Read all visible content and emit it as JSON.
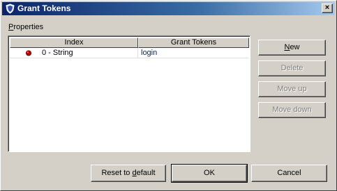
{
  "window": {
    "title": "Grant Tokens",
    "close_glyph": "×"
  },
  "properties": {
    "label_mnemonic": "P",
    "label_rest": "roperties"
  },
  "table": {
    "columns": [
      "Index",
      "Grant Tokens"
    ],
    "rows": [
      {
        "icon": "red-bullet-icon",
        "index": "0 - String",
        "value": "login"
      }
    ]
  },
  "side_buttons": {
    "new": {
      "mnemonic": "N",
      "rest": "ew"
    },
    "delete": "Delete",
    "move_up": "Move up",
    "move_down": "Move down"
  },
  "bottom_buttons": {
    "reset_pre": "Reset to ",
    "reset_mnemonic": "d",
    "reset_post": "efault",
    "ok": "OK",
    "cancel": "Cancel"
  },
  "colors": {
    "title_start": "#0a246a",
    "title_end": "#a6caf0",
    "face": "#d4d0c8",
    "bullet": "#c00000"
  }
}
